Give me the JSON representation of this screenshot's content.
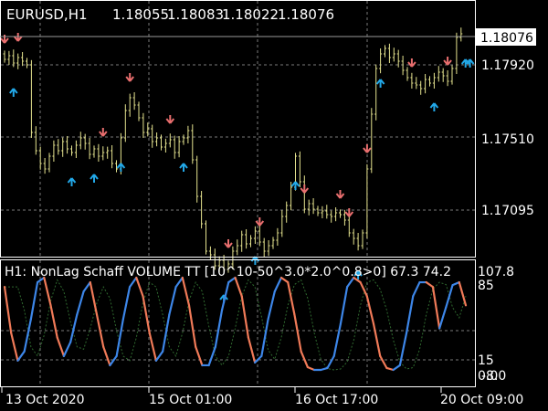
{
  "chart_data": {
    "type": "candlestick",
    "symbol_header": "EURUSD,H1",
    "ohlc_header": [
      "1.18055",
      "1.18083",
      "1.18022",
      "1.18076"
    ],
    "price_axis": {
      "ticks": [
        "1.17920",
        "1.17510",
        "1.17095"
      ],
      "current_price_label": "1.18076"
    },
    "time_axis": {
      "ticks": [
        "13 Oct 2020",
        "15 Oct 01:00",
        "16 Oct 17:00",
        "20 Oct 09:00"
      ]
    },
    "close_series": [
      1.1795,
      1.1797,
      1.1793,
      1.1796,
      1.1794,
      1.1792,
      1.1755,
      1.1745,
      1.1738,
      1.1735,
      1.1742,
      1.1748,
      1.1745,
      1.175,
      1.1746,
      1.1744,
      1.1748,
      1.1752,
      1.1749,
      1.1743,
      1.1746,
      1.1742,
      1.1744,
      1.1745,
      1.1738,
      1.1735,
      1.1752,
      1.1767,
      1.1774,
      1.177,
      1.1763,
      1.1755,
      1.1757,
      1.175,
      1.1752,
      1.1747,
      1.1749,
      1.1751,
      1.1744,
      1.175,
      1.1752,
      1.1756,
      1.174,
      1.172,
      1.1705,
      1.169,
      1.1688,
      1.1682,
      1.1685,
      1.168,
      1.1683,
      1.169,
      1.1693,
      1.1699,
      1.1694,
      1.1697,
      1.1701,
      1.1695,
      1.169,
      1.1693,
      1.1696,
      1.17,
      1.1709,
      1.1715,
      1.1725,
      1.1742,
      1.1728,
      1.1713,
      1.1716,
      1.1713,
      1.1711,
      1.1712,
      1.171,
      1.1709,
      1.1711,
      1.171,
      1.1707,
      1.17,
      1.1697,
      1.1693,
      1.17,
      1.1735,
      1.1765,
      1.179,
      1.1798,
      1.1801,
      1.1796,
      1.1798,
      1.1794,
      1.1789,
      1.1785,
      1.1782,
      1.1781,
      1.1779,
      1.1784,
      1.1782,
      1.1785,
      1.1788,
      1.1786,
      1.1783,
      1.179,
      1.1807,
      1.1809
    ],
    "indicator": {
      "label": "H1: NonLag Schaff VOLUME TT [10^10-50^3.0*2.0^0.8>0]  67.3 74.2",
      "axis_ticks": [
        "107.8",
        "85",
        "15",
        "0.0",
        "-8.0"
      ],
      "levels": [
        85,
        15
      ],
      "colors": {
        "rising": "#3d86e8",
        "falling": "#f07a58",
        "signal": "#2f6a2f"
      },
      "values": [
        90,
        40,
        10,
        20,
        55,
        95,
        100,
        70,
        35,
        15,
        30,
        60,
        85,
        95,
        60,
        25,
        5,
        15,
        55,
        90,
        100,
        80,
        40,
        10,
        20,
        60,
        90,
        100,
        70,
        25,
        5,
        5,
        25,
        65,
        95,
        100,
        80,
        35,
        8,
        15,
        55,
        85,
        100,
        95,
        60,
        20,
        3,
        0,
        0,
        2,
        15,
        50,
        90,
        100,
        95,
        80,
        50,
        15,
        2,
        0,
        5,
        40,
        80,
        95,
        95,
        90,
        45,
        68,
        92,
        95,
        70
      ]
    },
    "arrows_up": [
      2,
      15,
      20,
      26,
      40,
      49,
      56,
      65,
      79,
      84,
      96,
      103,
      104
    ],
    "arrows_down": [
      0,
      3,
      22,
      28,
      37,
      50,
      57,
      67,
      75,
      77,
      81,
      91,
      99
    ],
    "colors": {
      "background": "#000000",
      "candle": "#e5e38f",
      "grid": "#7a7a7a",
      "up_arrow": "#22a8e8",
      "down_arrow": "#e86e6e",
      "axis_text": "#ffffff"
    }
  }
}
